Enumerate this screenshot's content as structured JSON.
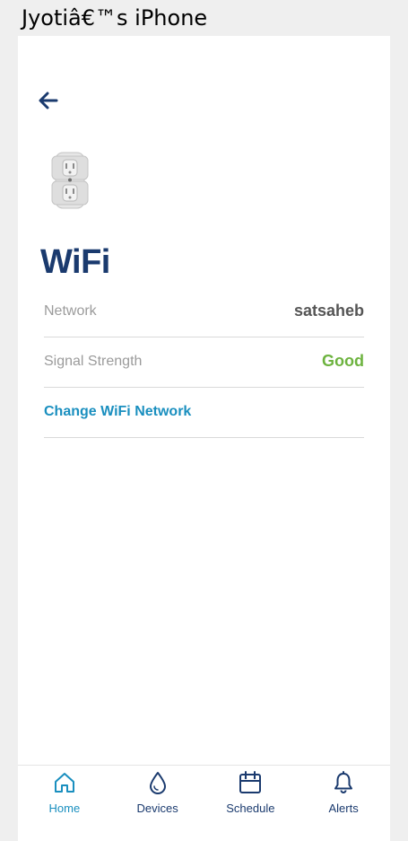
{
  "window": {
    "title": "Jyotiâ€™s iPhone"
  },
  "header": {
    "back_icon": "arrow-left-icon"
  },
  "device": {
    "image_icon": "outlet-device-icon"
  },
  "page": {
    "title": "WiFi"
  },
  "wifi": {
    "network_label": "Network",
    "network_value": "satsaheb",
    "signal_label": "Signal Strength",
    "signal_value": "Good",
    "change_link": "Change WiFi Network"
  },
  "nav": {
    "items": [
      {
        "label": "Home",
        "icon": "home-icon",
        "active": true
      },
      {
        "label": "Devices",
        "icon": "water-drop-icon",
        "active": false
      },
      {
        "label": "Schedule",
        "icon": "calendar-icon",
        "active": false
      },
      {
        "label": "Alerts",
        "icon": "bell-icon",
        "active": false
      }
    ]
  },
  "colors": {
    "brand_navy": "#1a3a6e",
    "link_blue": "#1a8fbf",
    "status_good": "#6db33f"
  }
}
